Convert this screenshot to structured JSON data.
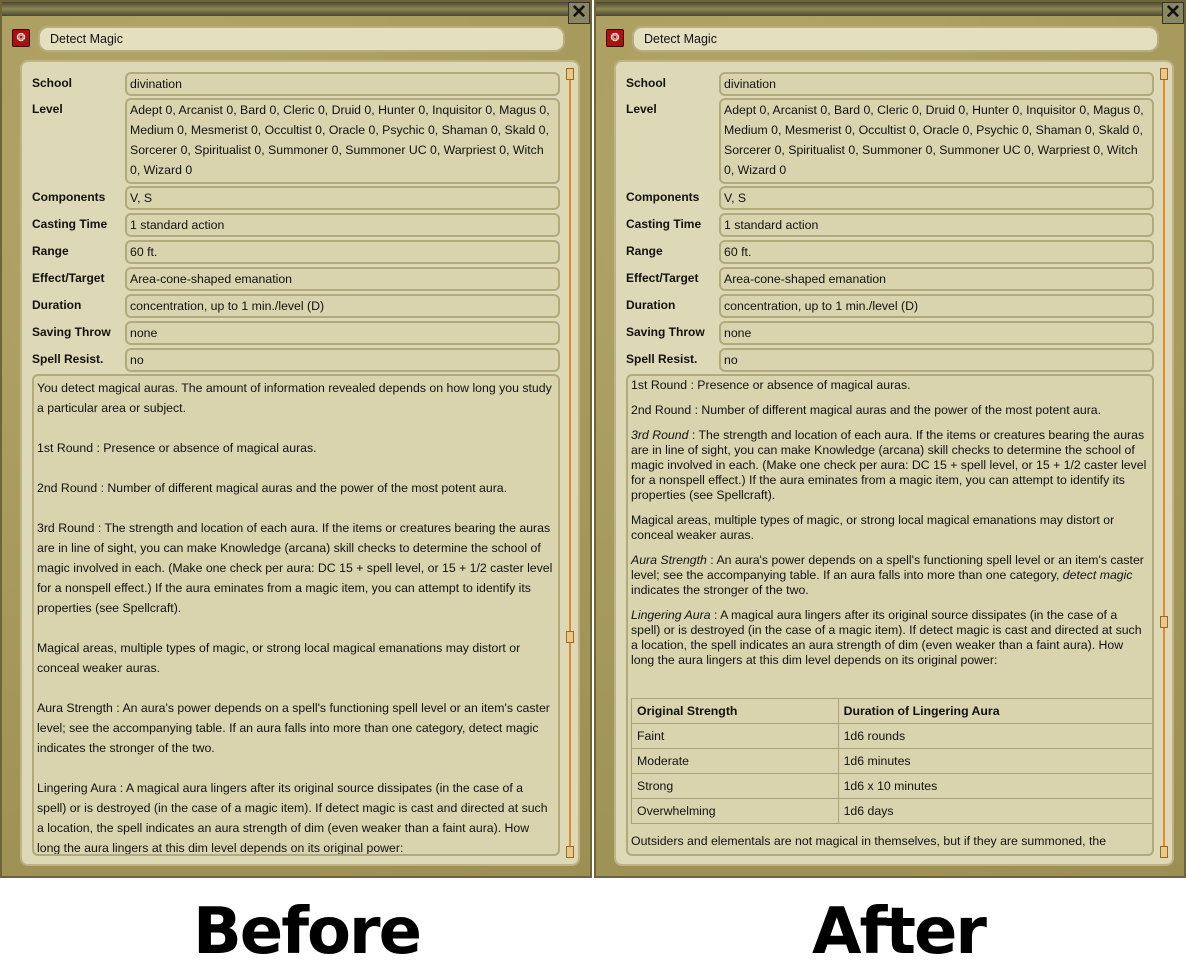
{
  "panels": [
    {
      "id": "before",
      "title": "Detect Magic",
      "close_label": "✕",
      "fields": [
        {
          "label": "School",
          "value": "divination"
        },
        {
          "label": "Level",
          "value": "Adept 0, Arcanist 0, Bard 0, Cleric 0, Druid 0, Hunter 0, Inquisitor 0, Magus 0, Medium 0, Mesmerist 0, Occultist 0, Oracle 0, Psychic 0, Shaman 0, Skald 0, Sorcerer 0, Spiritualist 0, Summoner 0, Summoner UC 0, Warpriest 0, Witch 0, Wizard 0"
        },
        {
          "label": "Components",
          "value": "V, S"
        },
        {
          "label": "Casting Time",
          "value": "1 standard action"
        },
        {
          "label": "Range",
          "value": "60 ft."
        },
        {
          "label": "Effect/Target",
          "value": "Area-cone-shaped emanation"
        },
        {
          "label": "Duration",
          "value": "concentration, up to 1 min./level (D)"
        },
        {
          "label": "Saving Throw",
          "value": "none"
        },
        {
          "label": "Spell Resist.",
          "value": "no"
        }
      ],
      "paragraphs": [
        [
          {
            "t": "You detect magical auras. The amount of information revealed depends on how long you study a particular area or subject."
          }
        ],
        [
          {
            "t": "1st Round : Presence or absence of magical auras."
          }
        ],
        [
          {
            "t": "2nd Round : Number of different magical auras and the power of the most potent aura."
          }
        ],
        [
          {
            "t": "3rd Round : The strength and location of each aura. If the items or creatures bearing the auras are in line of sight, you can make Knowledge (arcana) skill checks to determine the school of magic involved in each. (Make one check per aura: DC 15 + spell level, or 15 + 1/2 caster level for a nonspell effect.) If the aura eminates from a magic item, you can attempt to identify its properties (see Spellcraft)."
          }
        ],
        [
          {
            "t": "Magical areas, multiple types of magic, or strong local magical emanations may distort or conceal weaker auras."
          }
        ],
        [
          {
            "t": "Aura Strength : An aura's power depends on a spell's functioning spell level or an item's caster level; see the accompanying table. If an aura falls into more than one category, detect magic indicates the stronger of the two."
          }
        ],
        [
          {
            "t": "Lingering Aura : A magical aura lingers after its original source dissipates (in the case of a spell) or is destroyed (in the case of a magic item). If detect magic is cast and directed at such a location, the spell indicates an aura strength of dim (even weaker than a faint aura). How long the aura lingers at this dim level depends on its original power:"
          }
        ]
      ],
      "table": null,
      "after_table": null,
      "scroll_position": 0.75
    },
    {
      "id": "after",
      "title": "Detect Magic",
      "close_label": "✕",
      "fields": [
        {
          "label": "School",
          "value": "divination"
        },
        {
          "label": "Level",
          "value": "Adept 0, Arcanist 0, Bard 0, Cleric 0, Druid 0, Hunter 0, Inquisitor 0, Magus 0, Medium 0, Mesmerist 0, Occultist 0, Oracle 0, Psychic 0, Shaman 0, Skald 0, Sorcerer 0, Spiritualist 0, Summoner 0, Summoner UC 0, Warpriest 0, Witch 0, Wizard 0"
        },
        {
          "label": "Components",
          "value": "V, S"
        },
        {
          "label": "Casting Time",
          "value": "1 standard action"
        },
        {
          "label": "Range",
          "value": "60 ft."
        },
        {
          "label": "Effect/Target",
          "value": "Area-cone-shaped emanation"
        },
        {
          "label": "Duration",
          "value": "concentration, up to 1 min./level (D)"
        },
        {
          "label": "Saving Throw",
          "value": "none"
        },
        {
          "label": "Spell Resist.",
          "value": "no"
        }
      ],
      "paragraphs": [
        [
          {
            "t": "1st Round : Presence or absence of magical auras."
          }
        ],
        [
          {
            "t": "2nd Round : Number of different magical auras and the power of the most potent aura."
          }
        ],
        [
          {
            "t": "3rd Round",
            "i": true
          },
          {
            "t": " : The strength and location of each aura. If the items or creatures bearing the auras are in line of sight, you can make Knowledge (arcana) skill checks to determine the school of magic involved in each. (Make one check per aura: DC 15 + spell level, or 15 + 1/2 caster level for a nonspell effect.) If the aura eminates from a magic item, you can attempt to identify its properties (see Spellcraft)."
          }
        ],
        [
          {
            "t": "Magical areas, multiple types of magic, or strong local magical emanations may distort or conceal weaker auras."
          }
        ],
        [
          {
            "t": "Aura Strength",
            "i": true
          },
          {
            "t": " : An aura's power depends on a spell's functioning spell level or an item's caster level; see the accompanying table. If an aura falls into more than one category, "
          },
          {
            "t": "detect magic",
            "i": true
          },
          {
            "t": " indicates the stronger of the two."
          }
        ],
        [
          {
            "t": "Lingering Aura",
            "i": true
          },
          {
            "t": " : A magical aura lingers after its original source dissipates (in the case of a spell) or is destroyed (in the case of a magic item). If detect magic is cast and directed at such a location, the spell indicates an aura strength of dim (even weaker than a faint aura). How long the aura lingers at this dim level depends on its original power:"
          }
        ]
      ],
      "table": {
        "headers": [
          "Original Strength",
          "Duration of Lingering Aura"
        ],
        "rows": [
          [
            "Faint",
            "1d6 rounds"
          ],
          [
            "Moderate",
            "1d6 minutes"
          ],
          [
            "Strong",
            "1d6 x 10 minutes"
          ],
          [
            "Overwhelming",
            "1d6 days"
          ]
        ]
      },
      "after_table": "Outsiders and elementals are not magical in themselves, but if they are summoned, the",
      "scroll_position": 0.73
    }
  ],
  "captions": {
    "before": "Before",
    "after": "After"
  },
  "colors": {
    "parchment": "#ddd8b5",
    "frame": "#a89a5c",
    "scroll_track": "#e08a2a",
    "spell_icon": "#aa1111"
  }
}
